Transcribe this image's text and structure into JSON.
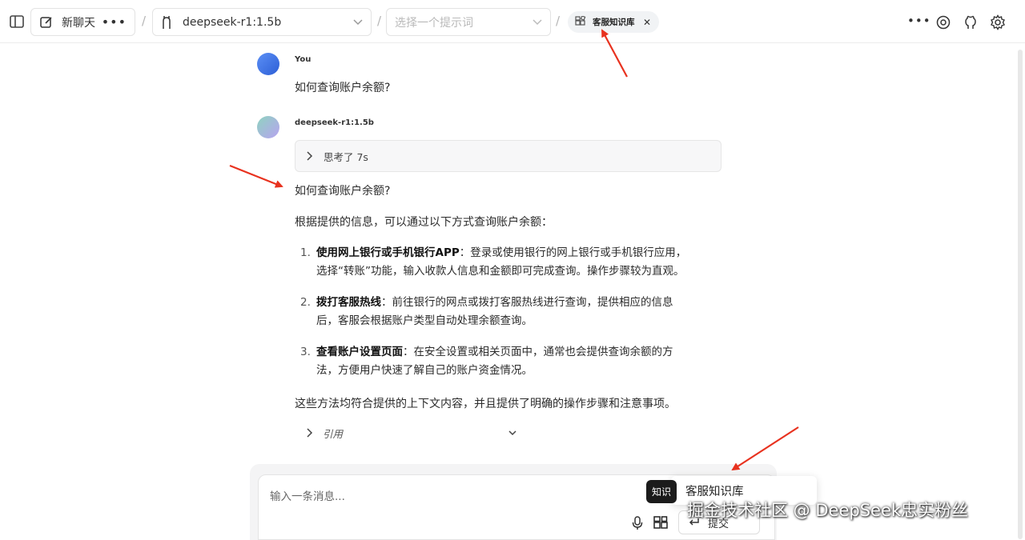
{
  "header": {
    "new_chat_label": "新聊天",
    "model_name": "deepseek-r1:1.5b",
    "prompt_placeholder": "选择一个提示词",
    "knowledge_chip": "客服知识库",
    "separator": "/"
  },
  "chat": {
    "user_name": "You",
    "user_message": "如何查询账户余额?",
    "bot_name": "deepseek-r1:1.5b",
    "thinking_label": "思考了 7s",
    "answer_title": "如何查询账户余额?",
    "answer_intro": "根据提供的信息，可以通过以下方式查询账户余额：",
    "list": [
      {
        "num": "1.",
        "bold": "使用网上银行或手机银行APP",
        "text": "：登录或使用银行的网上银行或手机银行应用，选择“转账”功能，输入收款人信息和金额即可完成查询。操作步骤较为直观。"
      },
      {
        "num": "2.",
        "bold": "拨打客服热线",
        "text": "：前往银行的网点或拨打客服热线进行查询，提供相应的信息后，客服会根据账户类型自动处理余额查询。"
      },
      {
        "num": "3.",
        "bold": "查看账户设置页面",
        "text": "：在安全设置或相关页面中，通常也会提供查询余额的方法，方便用户快速了解自己的账户资金情况。"
      }
    ],
    "answer_outro": "这些方法均符合提供的上下文内容，并且提供了明确的操作步骤和注意事项。",
    "citation_label": "引用"
  },
  "composer": {
    "placeholder": "输入一条消息...",
    "tooltip": "知识",
    "popup_item": "客服知识库",
    "submit_label": "提交"
  },
  "watermark": "掘金技术社区 @ DeepSeek忠实粉丝",
  "colors": {
    "annotation_arrow": "#e8321f",
    "user_avatar": "#3b6fe0",
    "bot_avatar": "#a6c8e8"
  }
}
